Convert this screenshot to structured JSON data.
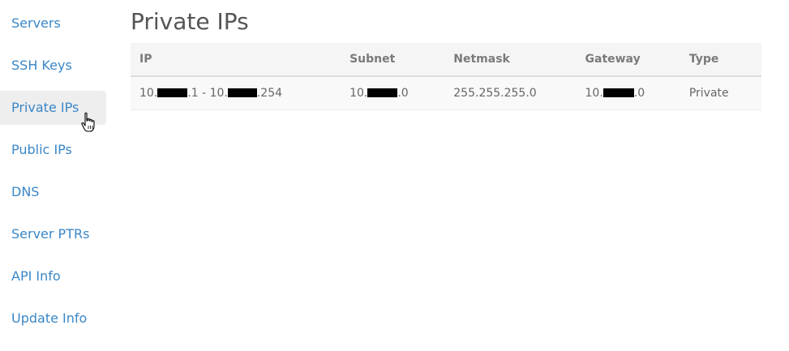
{
  "sidebar": {
    "items": [
      {
        "label": "Servers"
      },
      {
        "label": "SSH Keys"
      },
      {
        "label": "Private IPs"
      },
      {
        "label": "Public IPs"
      },
      {
        "label": "DNS"
      },
      {
        "label": "Server PTRs"
      },
      {
        "label": "API Info"
      },
      {
        "label": "Update Info"
      }
    ],
    "active": "Private IPs"
  },
  "main": {
    "title": "Private IPs",
    "table": {
      "headers": [
        "IP",
        "Subnet",
        "Netmask",
        "Gateway",
        "Type"
      ],
      "rows": [
        {
          "ip_prefix": "10.",
          "ip_mid": ".1 - 10.",
          "ip_suffix": ".254",
          "subnet_prefix": "10.",
          "subnet_suffix": ".0",
          "netmask": "255.255.255.0",
          "gateway_prefix": "10.",
          "gateway_suffix": ".0",
          "type": "Private"
        }
      ]
    }
  },
  "colors": {
    "link": "#3a87c8",
    "active_bg": "#eeeeee",
    "header_bg": "#f5f5f5",
    "redaction": "#000000"
  }
}
